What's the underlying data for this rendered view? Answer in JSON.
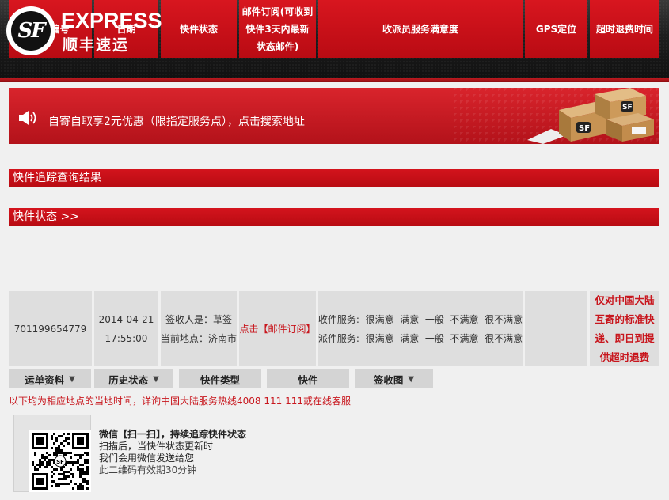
{
  "header": {
    "logo_mark": "SF",
    "logo_en": "EXPRESS",
    "logo_cn": "顺丰速运"
  },
  "banner": {
    "text": "自寄自取享2元优惠（限指定服务点），点击搜索地址",
    "box_label": "SF"
  },
  "section_title": "快件追踪查询结果",
  "status_title": "快件状态 >>",
  "table": {
    "headers": [
      "运单编号",
      "日期",
      "快件状态",
      "邮件订阅(可收到快件3天内最新状态邮件)",
      "收派员服务满意度",
      "GPS定位",
      "超时退费时间"
    ],
    "header_lines": {
      "subscribe": [
        "邮件订阅(可收到",
        "快件3天内最新",
        "状态邮件)"
      ],
      "timeout": "超时退费时间"
    },
    "row": {
      "waybill": "701199654779",
      "date": "2014-04-21",
      "time": "17:55:00",
      "status_line1": "签收人是：草签",
      "status_line2": "当前地点：济南市",
      "subscribe_link": "点击【邮件订阅】",
      "satisfaction_pickup": "收件服务:  很满意  满意  一般  不满意  很不满意",
      "satisfaction_delivery": "派件服务:  很满意  满意  一般  不满意  很不满意",
      "gps": "",
      "timeout_note_lines": [
        "仅对中国大陆",
        "互寄的标准快",
        "递、即日到提",
        "供超时退费"
      ]
    }
  },
  "tabs": [
    {
      "label": "运单资料",
      "has_arrow": true
    },
    {
      "label": "历史状态",
      "has_arrow": true
    },
    {
      "label": "快件类型",
      "has_arrow": false
    },
    {
      "label": "快件",
      "has_arrow": false
    },
    {
      "label": "签收图",
      "has_arrow": true
    }
  ],
  "tab_arrow": "▼",
  "notice": "以下均为相应地点的当地时间，详询中国大陆服务热线4008 111 111或在线客服",
  "wechat": {
    "line1": "微信【扫一扫】，持续追踪快件状态",
    "line2": "扫描后，当快件状态更新时",
    "line3": "我们会用微信发送给您",
    "line4": "此二维码有效期30分钟",
    "qr_center": "SF"
  },
  "colors": {
    "brand_red": "#c8161d",
    "header_dark": "#1e1e1e",
    "cell_gray": "#dedede"
  }
}
